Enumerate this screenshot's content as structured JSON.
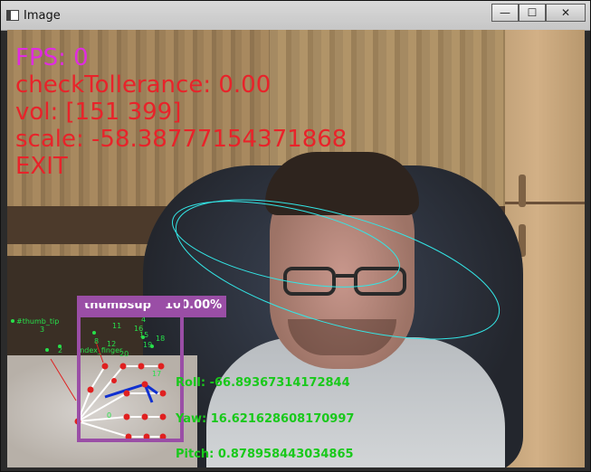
{
  "window": {
    "title": "Image",
    "minimize_glyph": "—",
    "maximize_glyph": "☐",
    "close_glyph": "✕"
  },
  "overlay": {
    "fps_text": "FPS: 0",
    "tolerance_text": "checkTollerance: 0.00",
    "vol_text": "vol: [151 399]",
    "scale_text": "scale: -58.38777154371868",
    "exit_text": "EXIT",
    "gesture_name": "thumbsup",
    "gesture_score": "100.00%",
    "roll_text": "Roll: -66.89367314172844",
    "yaw_text": "Yaw: 16.621628608170997",
    "pitch_text": "Pitch: 0.878958443034865",
    "landmark_labels": [
      "#thumb_tip",
      "3",
      "2",
      "index_finger",
      "4",
      "11",
      "8",
      "12",
      "16",
      "15",
      "19",
      "18",
      "17",
      "0",
      "20"
    ]
  },
  "colors": {
    "fps": "#e02be0",
    "info_red": "#e8232a",
    "gesture_box": "#9a4ea6",
    "pose_green": "#19c91b",
    "ellipse": "#33e6e6",
    "landmark_dot": "#e02020",
    "skeleton": "#ffffff",
    "thumb_line": "#1030d0"
  }
}
